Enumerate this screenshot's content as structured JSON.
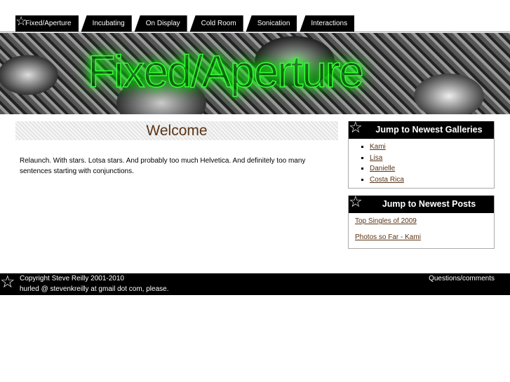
{
  "nav": {
    "tabs": [
      "Fixed/Aperture",
      "Incubating",
      "On Display",
      "Cold Room",
      "Sonication",
      "Interactions"
    ],
    "star_icon": "☆"
  },
  "banner": {
    "title": "Fixed/Aperture"
  },
  "main": {
    "heading": "Welcome",
    "intro": "Relaunch.  With stars. Lotsa stars. And probably too much Helvetica. And definitely too many sentences starting with conjunctions."
  },
  "galleries": {
    "title": "Jump to Newest Galleries",
    "items": [
      "Kami",
      "Lisa",
      "Danielle",
      "Costa Rica"
    ]
  },
  "posts": {
    "title": "Jump to Newest Posts",
    "items": [
      "Top Singles of 2009",
      "Photos so Far - Kami"
    ]
  },
  "footer": {
    "copyright": "Copyright Steve Reilly 2001-2010",
    "contact": "Questions/comments",
    "email": "hurled @  stevenkreilly at gmail dot com, please."
  },
  "colors": {
    "link": "#5a3315",
    "accent_glow": "#33ff33"
  }
}
